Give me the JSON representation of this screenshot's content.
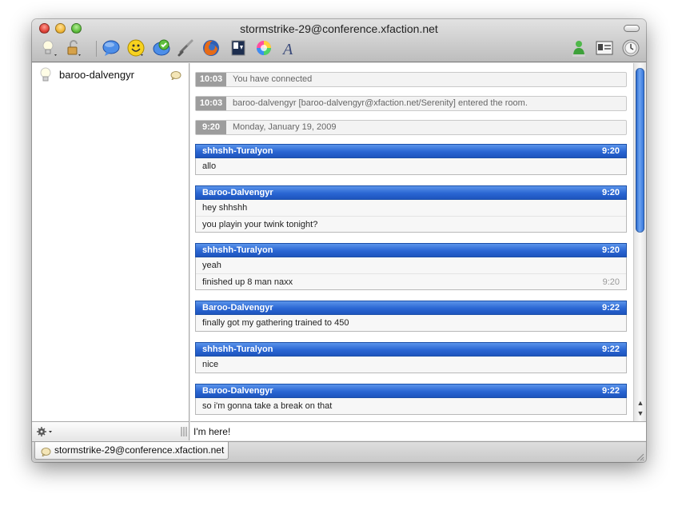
{
  "window": {
    "title": "stormstrike-29@conference.xfaction.net"
  },
  "toolbar": {
    "icons": [
      "status-bulb-icon",
      "lock-icon",
      "chat-bubble-icon",
      "smiley-icon",
      "checkmark-bubble-icon",
      "link-icon",
      "firefox-icon",
      "file-transfer-icon",
      "color-wheel-icon",
      "font-icon",
      "person-icon",
      "profile-card-icon",
      "history-clock-icon"
    ]
  },
  "sidebar": {
    "participants": [
      {
        "name": "baroo-dalvengyr"
      }
    ]
  },
  "chat": {
    "status_rows": [
      {
        "time": "10:03",
        "text": "You have connected"
      },
      {
        "time": "10:03",
        "text": "baroo-dalvengyr [baroo-dalvengyr@xfaction.net/Serenity] entered the room."
      },
      {
        "time": "9:20",
        "text": "Monday, January 19, 2009"
      }
    ],
    "messages": [
      {
        "sender": "shhshh-Turalyon",
        "time": "9:20",
        "lines": [
          "allo"
        ]
      },
      {
        "sender": "Baroo-Dalvengyr",
        "time": "9:20",
        "lines": [
          "hey shhshh",
          "you playin your twink tonight?"
        ]
      },
      {
        "sender": "shhshh-Turalyon",
        "time": "9:20",
        "lines": [
          "yeah",
          "finished up 8 man naxx"
        ],
        "line_times": [
          "",
          "9:20"
        ]
      },
      {
        "sender": "Baroo-Dalvengyr",
        "time": "9:22",
        "lines": [
          "finally got my gathering trained to 450"
        ]
      },
      {
        "sender": "shhshh-Turalyon",
        "time": "9:22",
        "lines": [
          "nice"
        ]
      },
      {
        "sender": "Baroo-Dalvengyr",
        "time": "9:22",
        "lines": [
          "so i'm gonna take a break on that"
        ]
      }
    ]
  },
  "input": {
    "value": "I'm here!"
  },
  "tabs": [
    {
      "label": "stormstrike-29@conference.xfaction.net"
    }
  ],
  "colors": {
    "header_blue": "#2a66d3",
    "status_gray": "#9d9d9d",
    "scroll_blue": "#2d6ed6"
  }
}
